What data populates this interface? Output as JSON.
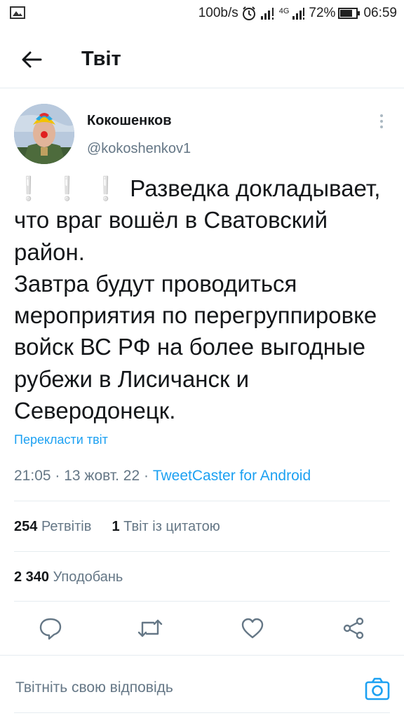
{
  "status_bar": {
    "network_speed": "100b/s",
    "network_type": "4G",
    "battery": "72%",
    "time": "06:59",
    "icons": [
      "image-icon",
      "alarm-icon",
      "signal-icon",
      "battery-icon"
    ]
  },
  "header": {
    "title": "Твіт",
    "back_icon": "arrow-left-icon"
  },
  "tweet": {
    "author_name": "Кокошенков",
    "author_handle": "@kokoshenkov1",
    "emphasis": "❕❕❕",
    "text": "Разведка докладывает, что враг вошёл в Сватовский район.\nЗавтра будут проводиться мероприятия по перегруппировке войск ВС РФ на более выгодные рубежи в Лисичанск и Северодонецк.",
    "translate_label": "Перекласти твіт",
    "time": "21:05",
    "date": "13 жовт. 22",
    "client": "TweetCaster for Android",
    "separator": " · "
  },
  "stats": {
    "retweets_count": "254",
    "retweets_label": "Ретвітів",
    "quotes_count": "1",
    "quotes_label": "Твіт із цитатою",
    "likes_count": "2 340",
    "likes_label": "Уподобань"
  },
  "actions": [
    "reply-icon",
    "retweet-icon",
    "like-icon",
    "share-icon"
  ],
  "reply": {
    "placeholder": "Твітніть свою відповідь",
    "camera_icon": "camera-icon"
  },
  "colors": {
    "accent": "#1da1f2",
    "secondary_text": "#657786",
    "primary_text": "#14171a",
    "divider": "#e6ecf0"
  }
}
